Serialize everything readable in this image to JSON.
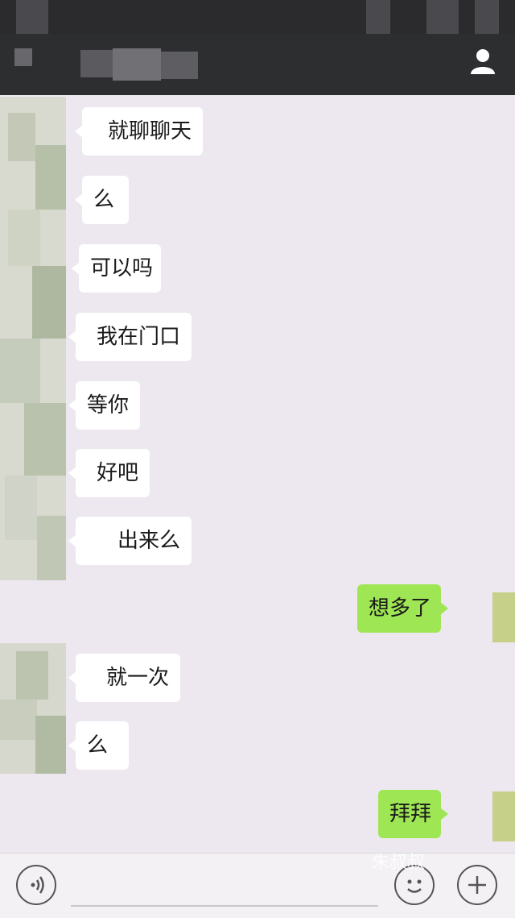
{
  "header": {
    "title": "",
    "profile_icon": "user-profile-icon"
  },
  "messages": [
    {
      "side": "in",
      "text": "就聊聊天"
    },
    {
      "side": "in",
      "text": "么"
    },
    {
      "side": "in",
      "text": "可以吗"
    },
    {
      "side": "in",
      "text": "我在门口"
    },
    {
      "side": "in",
      "text": "等你"
    },
    {
      "side": "in",
      "text": "好吧"
    },
    {
      "side": "in",
      "text": "出来么"
    },
    {
      "side": "out",
      "text": "想多了"
    },
    {
      "side": "in",
      "text": "就一次"
    },
    {
      "side": "in",
      "text": "么"
    },
    {
      "side": "out",
      "text": "拜拜"
    }
  ],
  "input_bar": {
    "voice_icon": "voice-icon",
    "emoji_icon": "emoji-icon",
    "add_icon": "plus-icon",
    "watermark": "朱叔叔"
  },
  "colors": {
    "outgoing_bubble": "#9fe655",
    "incoming_bubble": "#ffffff",
    "background": "#ede8ef",
    "header": "#2d2e30"
  }
}
